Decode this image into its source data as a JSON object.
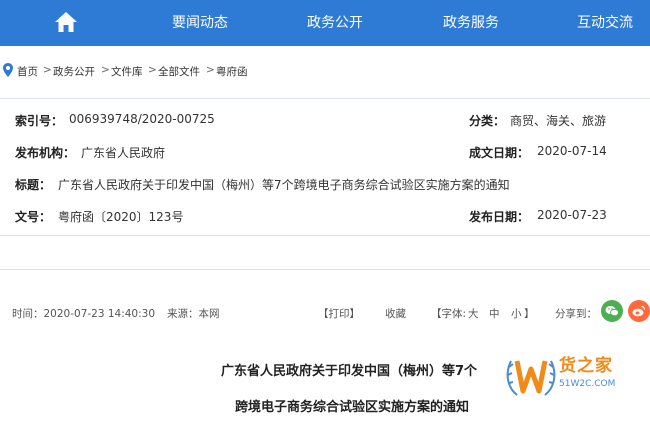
{
  "nav": {
    "items": [
      "要闻动态",
      "政务公开",
      "政务服务",
      "互动交流"
    ]
  },
  "breadcrumb": {
    "items": [
      "首页",
      "政务公开",
      "文件库",
      "全部文件",
      "粤府函"
    ],
    "separator": ">"
  },
  "info": {
    "index_label": "索引号：",
    "index_value": "006939748/2020-00725",
    "category_label": "分类：",
    "category_value": "商贸、海关、旅游",
    "issuer_label": "发布机构：",
    "issuer_value": "广东省人民政府",
    "created_label": "成文日期：",
    "created_value": "2020-07-14",
    "title_label": "标题：",
    "title_value": "广东省人民政府关于印发中国（梅州）等7个跨境电子商务综合试验区实施方案的通知",
    "docno_label": "文号：",
    "docno_value": "粤府函〔2020〕123号",
    "published_label": "发布日期：",
    "published_value": "2020-07-23"
  },
  "meta": {
    "time": "时间：2020-07-23 14:40:30",
    "source": "来源：本网",
    "print": "【打印】",
    "favorite": "收藏",
    "font_prefix": "【字体:",
    "font_large": "大",
    "font_medium": "中",
    "font_small": "小",
    "font_suffix": "】",
    "share_label": "分享到："
  },
  "article": {
    "title_line1": "广东省人民政府关于印发中国（梅州）等7个",
    "title_line2": "跨境电子商务综合试验区实施方案的通知"
  },
  "watermark": {
    "brand": "货之家",
    "url": "51W2C.COM"
  },
  "colors": {
    "nav_bg": "#2e7bd6",
    "border": "#d9e2ef",
    "wechat": "#4caf50",
    "weibo": "#ff6a3d",
    "watermark_orange": "#f08a1a",
    "watermark_blue": "#4b8ad6"
  },
  "icons": [
    "home-icon",
    "location-pin-icon",
    "wechat-icon",
    "weibo-icon",
    "w-logo-icon"
  ]
}
